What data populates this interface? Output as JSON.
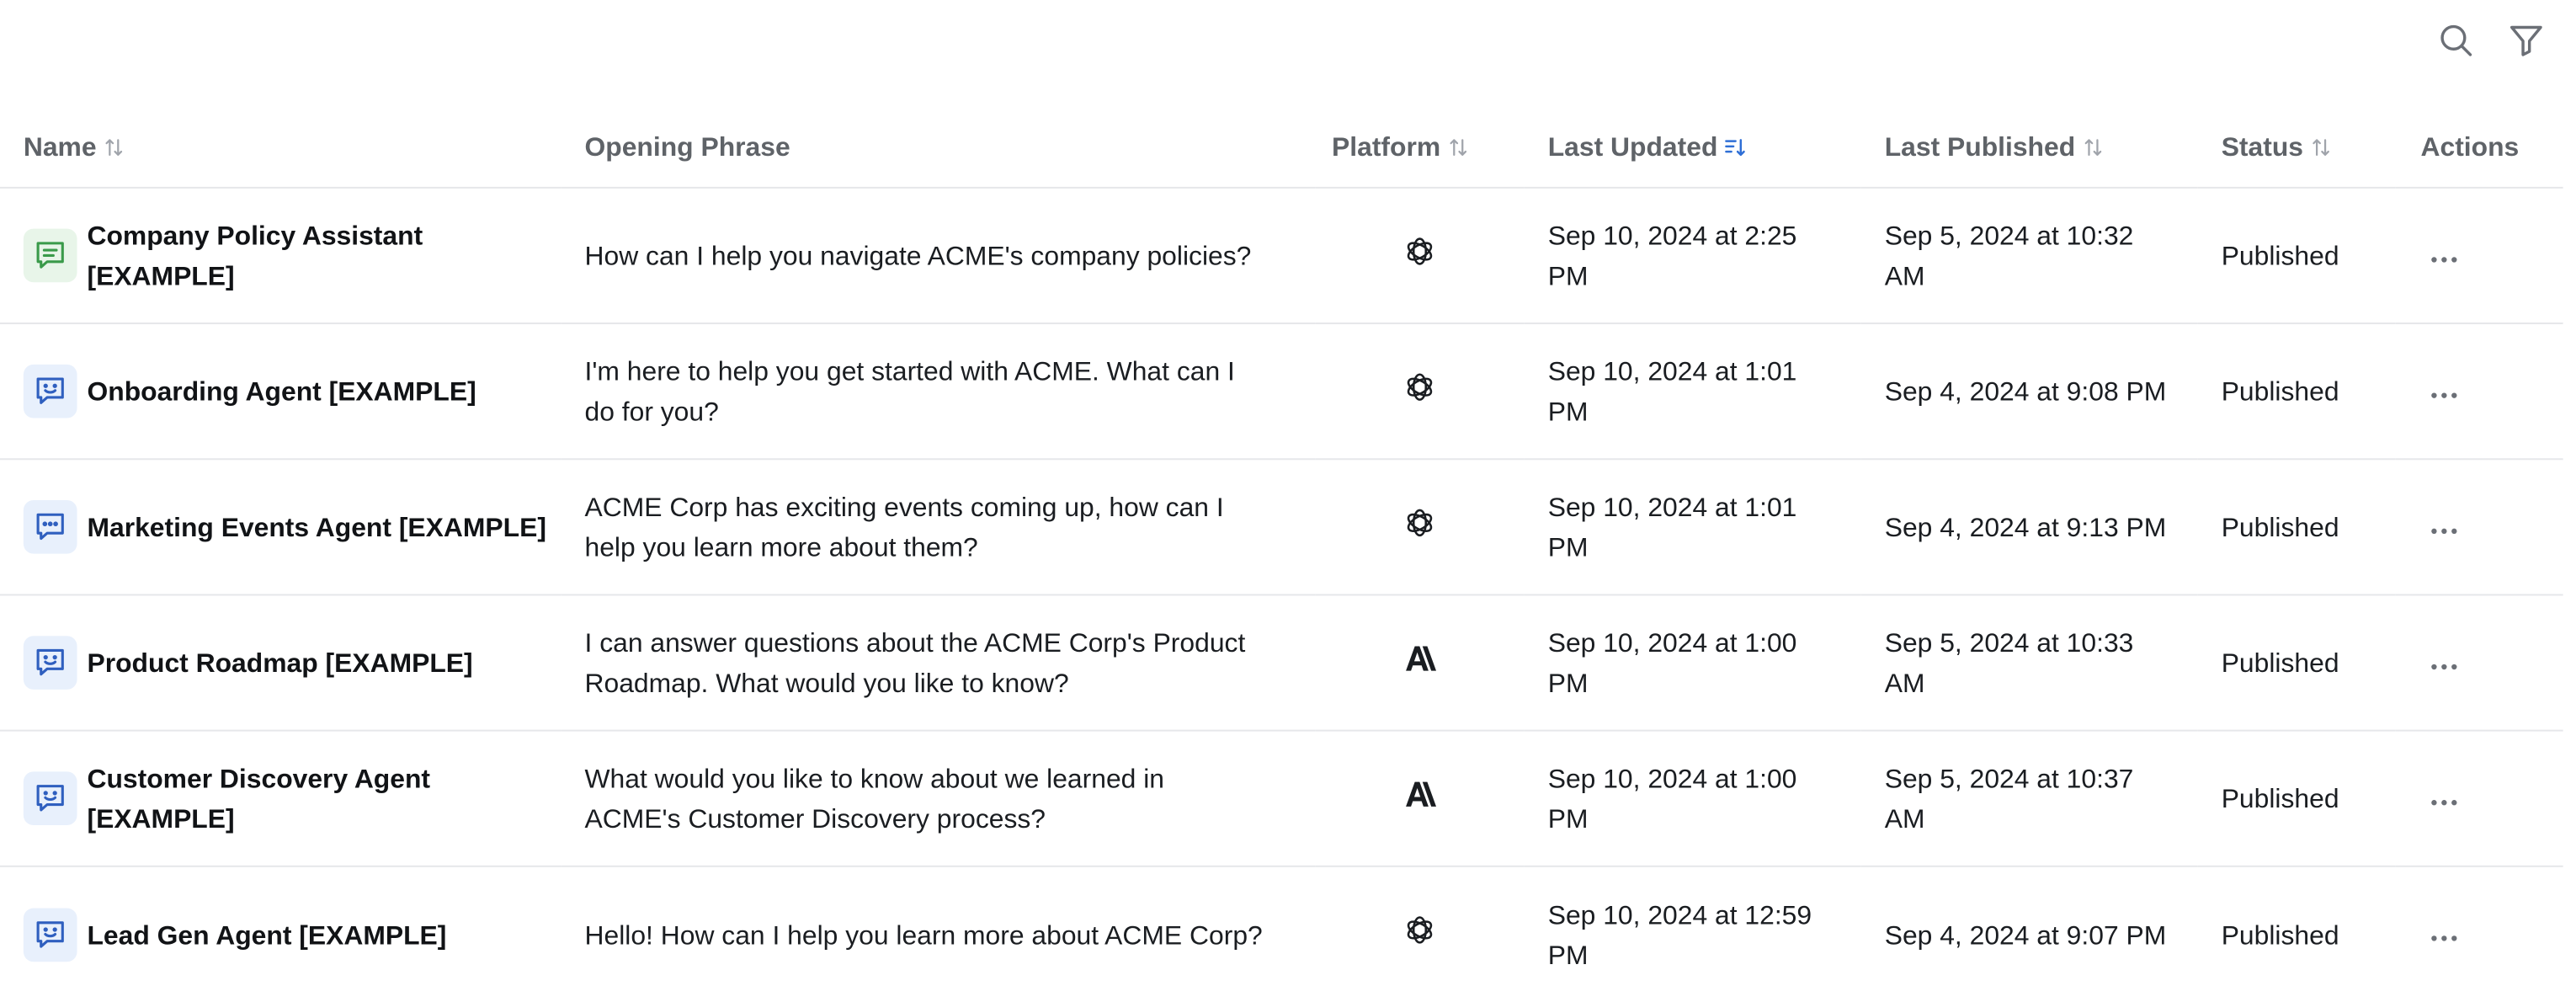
{
  "table": {
    "columns": {
      "name": "Name",
      "opening_phrase": "Opening Phrase",
      "platform": "Platform",
      "last_updated": "Last Updated",
      "last_published": "Last Published",
      "status": "Status",
      "actions": "Actions"
    },
    "sorted_column": "last_updated",
    "rows": [
      {
        "name": "Company Policy Assistant [EXAMPLE]",
        "icon": "chat-lines-icon",
        "icon_color": "#3a9a4a",
        "icon_bg": "#e8f5e9",
        "opening_phrase": "How can I help you navigate ACME's company policies?",
        "platform": "openai-icon",
        "last_updated": "Sep 10, 2024 at 2:25 PM",
        "last_published": "Sep 5, 2024 at 10:32 AM",
        "status": "Published"
      },
      {
        "name": "Onboarding Agent [EXAMPLE]",
        "icon": "chat-smile-icon",
        "icon_color": "#2f5fbf",
        "icon_bg": "#e8f0fc",
        "opening_phrase": "I'm here to help you get started with ACME. What can I do for you?",
        "platform": "openai-icon",
        "last_updated": "Sep 10, 2024 at 1:01 PM",
        "last_published": "Sep 4, 2024 at 9:08 PM",
        "status": "Published"
      },
      {
        "name": "Marketing Events Agent [EXAMPLE]",
        "icon": "chat-dots-icon",
        "icon_color": "#2f5fbf",
        "icon_bg": "#e8f0fc",
        "opening_phrase": "ACME Corp has exciting events coming up, how can I help you learn more about them?",
        "platform": "openai-icon",
        "last_updated": "Sep 10, 2024 at 1:01 PM",
        "last_published": "Sep 4, 2024 at 9:13 PM",
        "status": "Published"
      },
      {
        "name": "Product Roadmap [EXAMPLE]",
        "icon": "chat-smile-icon",
        "icon_color": "#2f5fbf",
        "icon_bg": "#e8f0fc",
        "opening_phrase": "I can answer questions about the ACME Corp's Product Roadmap. What would you like to know?",
        "platform": "anthropic-icon",
        "last_updated": "Sep 10, 2024 at 1:00 PM",
        "last_published": "Sep 5, 2024 at 10:33 AM",
        "status": "Published"
      },
      {
        "name": "Customer Discovery Agent [EXAMPLE]",
        "icon": "chat-smile-icon",
        "icon_color": "#2f5fbf",
        "icon_bg": "#e8f0fc",
        "opening_phrase": "What would you like to know about we learned in ACME's Customer Discovery process?",
        "platform": "anthropic-icon",
        "last_updated": "Sep 10, 2024 at 1:00 PM",
        "last_published": "Sep 5, 2024 at 10:37 AM",
        "status": "Published"
      },
      {
        "name": "Lead Gen Agent [EXAMPLE]",
        "icon": "chat-smile-icon",
        "icon_color": "#2f5fbf",
        "icon_bg": "#e8f0fc",
        "opening_phrase": "Hello! How can I help you learn more about ACME Corp?",
        "platform": "openai-icon",
        "last_updated": "Sep 10, 2024 at 12:59 PM",
        "last_published": "Sep 4, 2024 at 9:07 PM",
        "status": "Published"
      }
    ]
  },
  "toolbar": {
    "search_icon": "search-icon",
    "filter_icon": "filter-icon"
  },
  "colors": {
    "accent": "#2f6fd6",
    "muted": "#a0a4ab",
    "border": "#e6e7ea"
  }
}
